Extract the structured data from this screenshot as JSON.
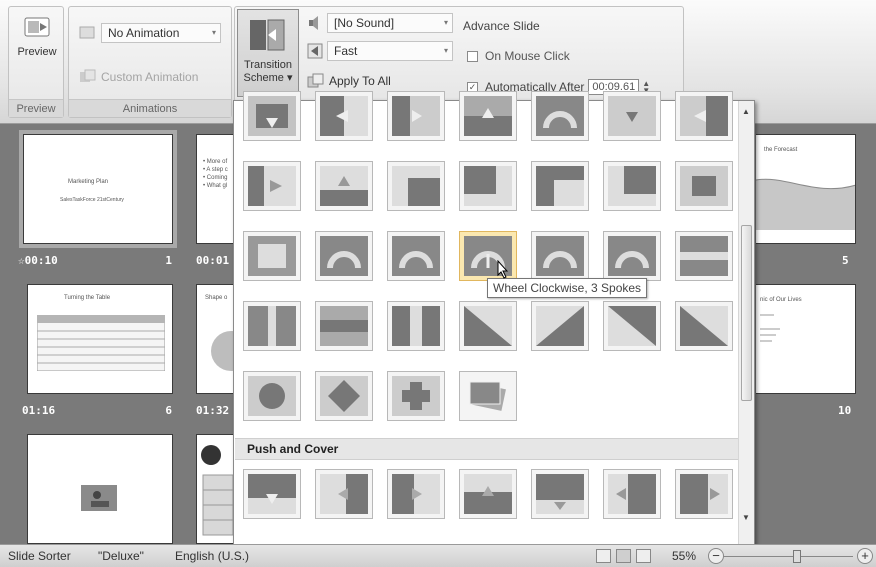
{
  "ribbon": {
    "preview_group": {
      "button_label": "Preview",
      "group_label": "Preview"
    },
    "animations_group": {
      "animation_select": "No Animation",
      "custom_animation_label": "Custom Animation",
      "group_label": "Animations"
    },
    "transition": {
      "scheme_label_line1": "Transition",
      "scheme_label_line2": "Scheme ▾",
      "sound_select": "[No Sound]",
      "speed_select": "Fast",
      "apply_all_label": "Apply To All"
    },
    "advance": {
      "heading": "Advance Slide",
      "on_mouse_click_label": "On Mouse Click",
      "on_mouse_click_checked": false,
      "auto_after_label": "Automatically After",
      "auto_after_checked": true,
      "auto_after_value": "00:09.61"
    }
  },
  "slides": [
    {
      "time": "00:10",
      "number": "1",
      "title": "Marketing Plan",
      "subtitle": "SalesTaskForce 21stCentury",
      "starred": true
    },
    {
      "time": "00:01",
      "number": "",
      "bullets": [
        "• More of",
        "• A step c",
        "• Coming",
        "• What gl"
      ]
    },
    {
      "number": "5",
      "title": "the Forecast"
    },
    {
      "time": "01:16",
      "number": "6",
      "title": "Turning the Table"
    },
    {
      "time": "01:32",
      "number": "",
      "title": "Shape o"
    },
    {
      "number": "10",
      "title": "nic of Our Lives"
    }
  ],
  "gallery": {
    "section_push_cover": "Push and Cover",
    "tooltip": "Wheel Clockwise, 3 Spokes"
  },
  "statusbar": {
    "view": "Slide Sorter",
    "theme": "\"Deluxe\"",
    "language": "English (U.S.)",
    "zoom": "55%"
  }
}
